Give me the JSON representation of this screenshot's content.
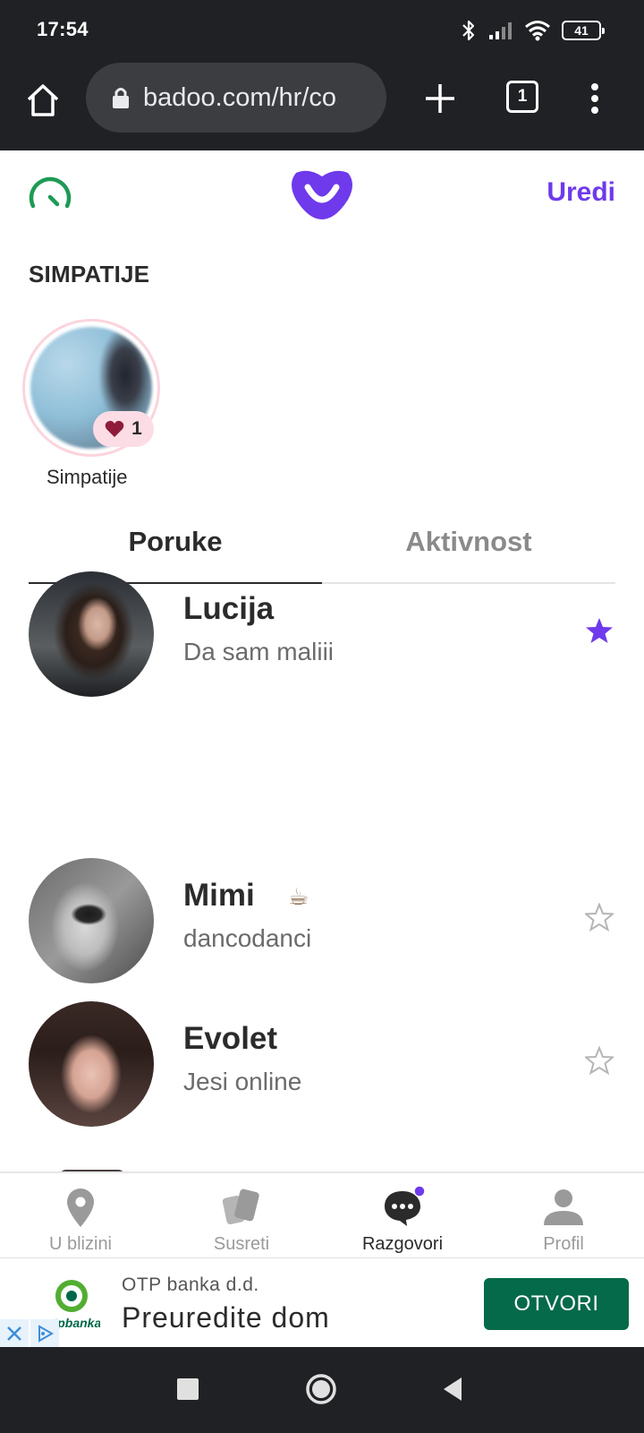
{
  "status_bar": {
    "time": "17:54",
    "battery": "41"
  },
  "browser": {
    "url": "badoo.com/hr/co",
    "tab_count": "1"
  },
  "header": {
    "edit_label": "Uredi"
  },
  "likes": {
    "section_title": "SIMPATIJE",
    "count": "1",
    "label": "Simpatije"
  },
  "tabs": [
    {
      "label": "Poruke",
      "active": true
    },
    {
      "label": "Aktivnost",
      "active": false
    }
  ],
  "conversations": [
    {
      "name": "Lucija",
      "message": "Da sam maliii",
      "starred": true
    },
    {
      "name": "Mimi",
      "emoji": "☕",
      "message": "dancodanci",
      "starred": false
    },
    {
      "name": "Evolet",
      "message": "Jesi online",
      "starred": false
    }
  ],
  "bottom_nav": [
    {
      "label": "U blizini",
      "icon": "location-pin-icon",
      "active": false
    },
    {
      "label": "Susreti",
      "icon": "cards-icon",
      "active": false
    },
    {
      "label": "Razgovori",
      "icon": "chat-bubble-icon",
      "active": true,
      "has_notification": true
    },
    {
      "label": "Profil",
      "icon": "person-icon",
      "active": false
    }
  ],
  "ad": {
    "sponsor": "OTP banka d.d.",
    "headline": "Preuredite dom",
    "cta": "OTVORI",
    "logo_text": "otpbanka"
  },
  "colors": {
    "accent": "#6e3aeb",
    "cta_green": "#056a4a",
    "dark_bar": "#202124",
    "likes_badge": "#fcdde5",
    "heart": "#8e1b3a"
  }
}
